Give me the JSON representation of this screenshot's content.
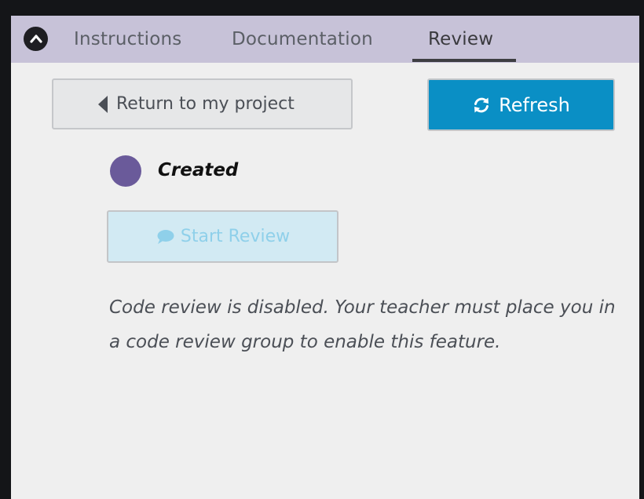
{
  "tabs": {
    "collapse_icon": "chevron-up-circle-icon",
    "items": [
      {
        "label": "Instructions",
        "active": false
      },
      {
        "label": "Documentation",
        "active": false
      },
      {
        "label": "Review",
        "active": true
      }
    ]
  },
  "actions": {
    "return_label": "Return to my project",
    "return_icon": "caret-left-icon",
    "refresh_label": "Refresh",
    "refresh_icon": "refresh-icon"
  },
  "status": {
    "label": "Created",
    "dot_color": "#6a5a9a"
  },
  "review": {
    "start_label": "Start Review",
    "start_icon": "comment-icon",
    "start_disabled": true,
    "notice": "Code review is disabled. Your teacher must place you in a code review group to enable this feature."
  },
  "colors": {
    "tabbar": "#c7c2d8",
    "primary": "#0a8fc5",
    "disabled_bg": "#d2eaf3",
    "disabled_text": "#8fd0ea"
  }
}
